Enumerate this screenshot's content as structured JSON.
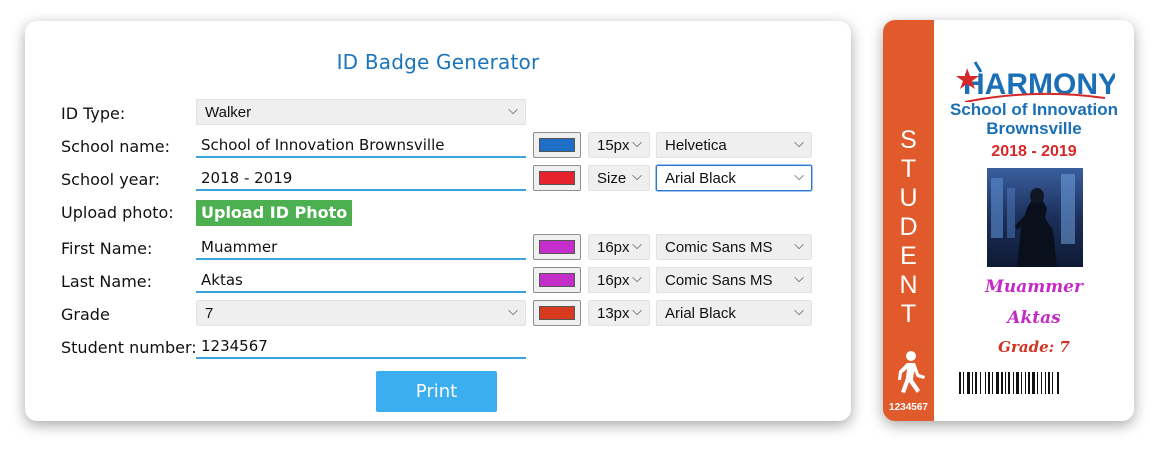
{
  "form": {
    "title": "ID Badge Generator",
    "id_type": {
      "label": "ID Type:",
      "value": "Walker"
    },
    "school_name": {
      "label": "School name:",
      "value": "School of Innovation  Brownsville",
      "color": "#1e6fc8",
      "size": "15px",
      "font": "Helvetica"
    },
    "school_year": {
      "label": "School year:",
      "value": "2018 - 2019",
      "color": "#e5222d",
      "size": "Size",
      "font": "Arial Black"
    },
    "upload": {
      "label": "Upload photo:",
      "button": "Upload ID Photo"
    },
    "first_name": {
      "label": "First Name:",
      "value": "Muammer",
      "color": "#c52dcb",
      "size": "16px",
      "font": "Comic Sans MS"
    },
    "last_name": {
      "label": "Last Name:",
      "value": "Aktas",
      "color": "#c52dcb",
      "size": "16px",
      "font": "Comic Sans MS"
    },
    "grade": {
      "label": "Grade",
      "value": "7",
      "color": "#d83a20",
      "size": "13px",
      "font": "Arial Black"
    },
    "student_number": {
      "label": "Student number:",
      "value": "1234567"
    },
    "print_button": "Print"
  },
  "badge": {
    "type_text": "STUDENT",
    "type_letters": [
      "S",
      "T",
      "U",
      "D",
      "E",
      "N",
      "T"
    ],
    "stripe_color": "#e05a2b",
    "logo_text": "HARMONY",
    "school_line1": "School of Innovation",
    "school_line2": "Brownsville",
    "year": "2018 - 2019",
    "first_name": "Muammer",
    "last_name": "Aktas",
    "grade": "Grade:  7",
    "student_number": "1234567",
    "icons": {
      "runner": "walking-person-icon",
      "barcode": "barcode-icon"
    }
  }
}
